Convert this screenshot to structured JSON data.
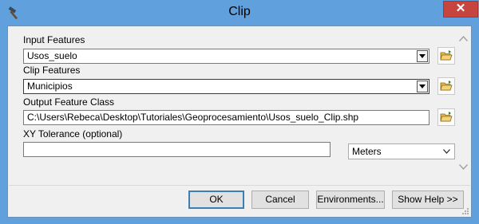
{
  "window": {
    "title": "Clip",
    "close_symbol": "✕",
    "title_icon": "hammer-icon"
  },
  "form": {
    "input_features": {
      "label": "Input Features",
      "value": "Usos_suelo"
    },
    "clip_features": {
      "label": "Clip Features",
      "value": "Municipios"
    },
    "output_feature_class": {
      "label": "Output Feature Class",
      "value": "C:\\Users\\Rebeca\\Desktop\\Tutoriales\\Geoprocesamiento\\Usos_suelo_Clip.shp"
    },
    "xy_tolerance": {
      "label": "XY Tolerance (optional)",
      "value": "",
      "unit": "Meters"
    }
  },
  "buttons": {
    "ok": "OK",
    "cancel": "Cancel",
    "environments": "Environments...",
    "show_help": "Show Help >>"
  },
  "colors": {
    "titlebar": "#5fa0dd",
    "close": "#c8453f",
    "dialog_bg": "#f0f0f0",
    "default_button_border": "#3c7fb1"
  }
}
